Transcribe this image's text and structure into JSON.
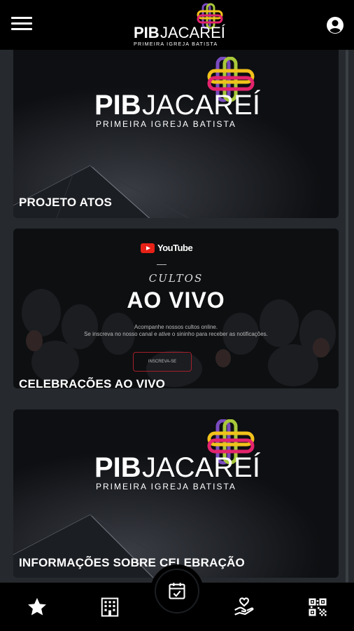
{
  "header": {
    "menu_icon": "hamburger-menu-icon",
    "user_icon": "account-circle-icon",
    "logo_text_pib": "PIB",
    "logo_text_jacarei": "JACAREÍ",
    "logo_tagline": "PRIMEIRA IGREJA BATISTA"
  },
  "cards": [
    {
      "title": "PROJETO ATOS",
      "logo_text_pib": "PIB",
      "logo_text_jacarei": "JACAREÍ",
      "logo_tagline": "PRIMEIRA IGREJA BATISTA"
    },
    {
      "title": "CELEBRAÇÕES AO VIVO",
      "youtube_label": "YouTube",
      "cultos": "CULTOS",
      "ao_vivo": "AO VIVO",
      "line1": "Acompanhe nossos cultos online.",
      "line2": "Se inscreva no nosso canal e ative o sininho para receber as notificações.",
      "button": "INSCREVA-SE"
    },
    {
      "title": "INFORMAÇÕES SOBRE CELEBRAÇÃO",
      "logo_text_pib": "PIB",
      "logo_text_jacarei": "JACAREÍ",
      "logo_tagline": "PRIMEIRA IGREJA BATISTA"
    }
  ],
  "bottom_nav": {
    "items": [
      "star-icon",
      "building-icon",
      "calendar-check-icon",
      "hand-heart-icon",
      "qr-code-icon"
    ]
  },
  "colors": {
    "background": "#262a2e",
    "bar": "#000000",
    "card": "#0d0f12",
    "logo_yellow": "#f2c21b",
    "logo_pink": "#e3246d",
    "logo_purple": "#7a4bbf",
    "logo_green": "#a9c93a",
    "youtube_red": "#e62117"
  }
}
